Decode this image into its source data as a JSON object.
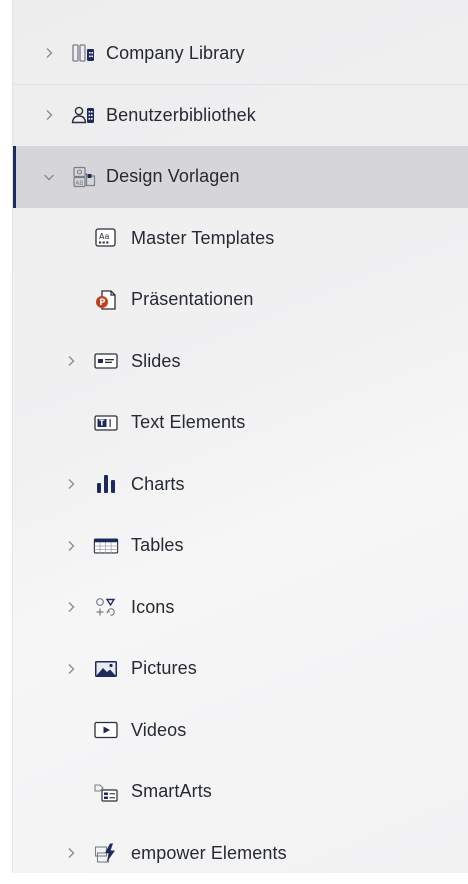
{
  "tree": {
    "items": [
      {
        "label": "Company Library",
        "icon": "building-library-icon",
        "level": 0,
        "expandable": true,
        "expanded": false,
        "selected": false
      },
      {
        "label": "Benutzerbibliothek",
        "icon": "user-library-icon",
        "level": 0,
        "expandable": true,
        "expanded": false,
        "selected": false
      },
      {
        "label": "Design Vorlagen",
        "icon": "design-templates-icon",
        "level": 0,
        "expandable": true,
        "expanded": true,
        "selected": true
      },
      {
        "label": "Master Templates",
        "icon": "master-template-icon",
        "level": 1,
        "expandable": false
      },
      {
        "label": "Präsentationen",
        "icon": "powerpoint-file-icon",
        "level": 1,
        "expandable": false
      },
      {
        "label": "Slides",
        "icon": "slide-icon",
        "level": 1,
        "expandable": true
      },
      {
        "label": "Text Elements",
        "icon": "text-element-icon",
        "level": 1,
        "expandable": false
      },
      {
        "label": "Charts",
        "icon": "bar-chart-icon",
        "level": 1,
        "expandable": true
      },
      {
        "label": "Tables",
        "icon": "table-icon",
        "level": 1,
        "expandable": true
      },
      {
        "label": "Icons",
        "icon": "icons-shapes-icon",
        "level": 1,
        "expandable": true
      },
      {
        "label": "Pictures",
        "icon": "picture-icon",
        "level": 1,
        "expandable": true
      },
      {
        "label": "Videos",
        "icon": "video-icon",
        "level": 1,
        "expandable": false
      },
      {
        "label": "SmartArts",
        "icon": "smartart-icon",
        "level": 1,
        "expandable": false
      },
      {
        "label": "empower Elements",
        "icon": "empower-elements-icon",
        "level": 1,
        "expandable": true
      }
    ]
  },
  "colors": {
    "selection_bg": "#d6d6d8",
    "selection_bar": "#1d2a5c",
    "icon_navy": "#1d2a5c",
    "icon_red": "#c43e1c"
  }
}
